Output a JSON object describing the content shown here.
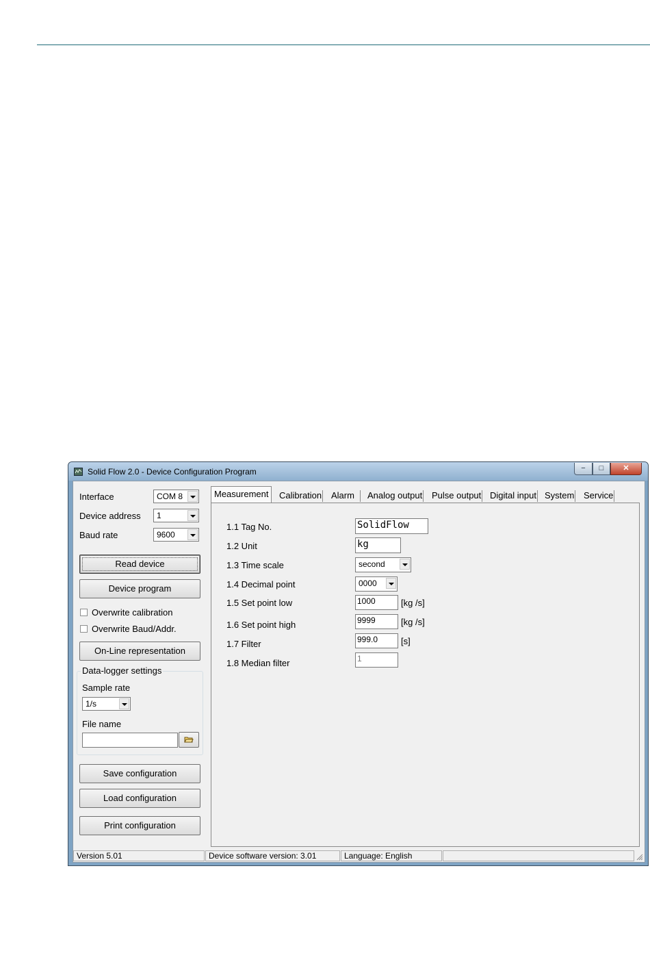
{
  "window": {
    "title": "Solid Flow 2.0 - Device Configuration Program",
    "minimize_glyph": "−",
    "maximize_glyph": "□",
    "close_glyph": "✕"
  },
  "left_panel": {
    "interface_label": "Interface",
    "interface_value": "COM 8",
    "device_address_label": "Device address",
    "device_address_value": "1",
    "baud_rate_label": "Baud rate",
    "baud_rate_value": "9600",
    "read_device_label": "Read device",
    "device_program_label": "Device program",
    "overwrite_calibration_label": "Overwrite calibration",
    "overwrite_calibration_checked": false,
    "overwrite_baud_label": "Overwrite Baud/Addr.",
    "overwrite_baud_checked": false,
    "online_representation_label": "On-Line representation",
    "datalogger": {
      "group_label": "Data-logger settings",
      "sample_rate_label": "Sample rate",
      "sample_rate_value": "1/s",
      "file_name_label": "File name",
      "file_name_value": ""
    },
    "save_configuration_label": "Save configuration",
    "load_configuration_label": "Load configuration",
    "print_configuration_label": "Print configuration"
  },
  "tabs": [
    {
      "label": "Measurement",
      "active": true
    },
    {
      "label": "Calibration",
      "active": false
    },
    {
      "label": "Alarm",
      "active": false
    },
    {
      "label": "Analog output",
      "active": false
    },
    {
      "label": "Pulse output",
      "active": false
    },
    {
      "label": "Digital input",
      "active": false
    },
    {
      "label": "System",
      "active": false
    },
    {
      "label": "Service",
      "active": false
    }
  ],
  "measurement": {
    "tag_no": {
      "label": "1.1 Tag No.",
      "value": "SolidFlow"
    },
    "unit": {
      "label": "1.2 Unit",
      "value": "kg"
    },
    "time_scale": {
      "label": "1.3 Time scale",
      "value": "second"
    },
    "decimal_point": {
      "label": "1.4 Decimal point",
      "value": "0000"
    },
    "set_point_low": {
      "label": "1.5 Set point low",
      "value": "1000",
      "unit": "[kg  /s]"
    },
    "set_point_high": {
      "label": "1.6 Set point high",
      "value": "9999",
      "unit": "[kg  /s]"
    },
    "filter": {
      "label": "1.7 Filter",
      "value": "999.0",
      "unit": "[s]"
    },
    "median_filter": {
      "label": "1.8 Median filter",
      "value": "1"
    }
  },
  "status_bar": {
    "version": "Version 5.01",
    "device_software": "Device software version: 3.01",
    "language": "Language: English",
    "extra": ""
  },
  "colors": {
    "accent_rule": "#1f6b78",
    "title_bar": "#8fb0cf",
    "close_button": "#c0432c",
    "window_face": "#f0f0f0"
  }
}
